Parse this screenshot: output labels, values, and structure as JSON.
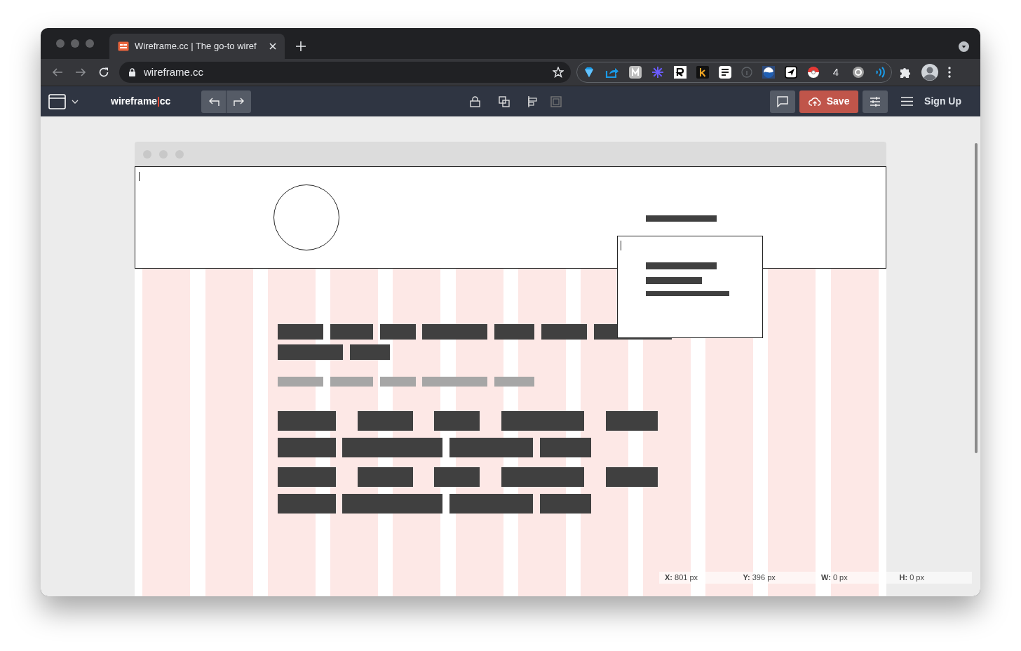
{
  "browser": {
    "tab": {
      "title": "Wireframe.cc | The go-to wiref",
      "selected": true
    },
    "address": "wireframe.cc",
    "extension_badge": "4"
  },
  "toolbar": {
    "logo": [
      "wireframe",
      "cc"
    ],
    "save": "Save",
    "sign_up": "Sign Up"
  },
  "status_bar": [
    "**X:** 801 px",
    "**Y:** 396 px",
    "**W:** 0 px",
    "**H:** 0 px"
  ]
}
